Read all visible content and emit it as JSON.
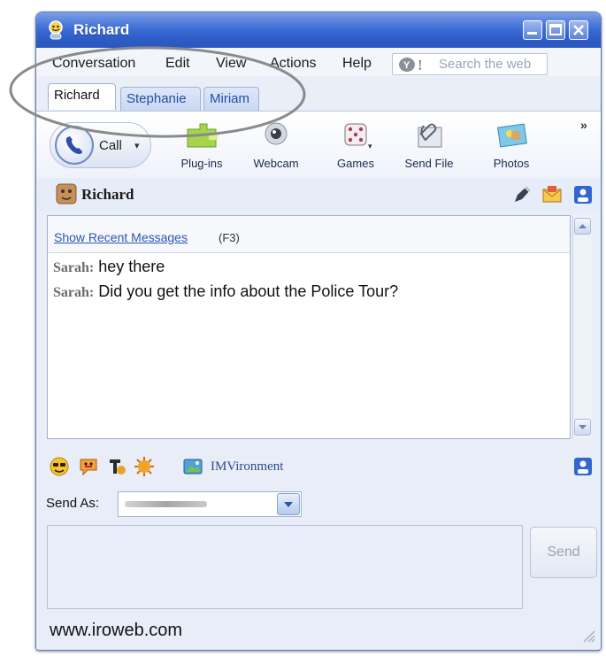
{
  "window": {
    "title": "Richard",
    "accent": "#3d6fd6"
  },
  "menu": {
    "items": [
      "Conversation",
      "Edit",
      "View",
      "Actions",
      "Help"
    ]
  },
  "search": {
    "placeholder": "Search the web"
  },
  "tabs": [
    {
      "label": "Richard",
      "active": true
    },
    {
      "label": "Stephanie",
      "active": false
    },
    {
      "label": "Miriam",
      "active": false
    }
  ],
  "toolbar": {
    "call": "Call",
    "items": [
      "Plug-ins",
      "Webcam",
      "Games",
      "Send File",
      "Photos"
    ],
    "more": "»"
  },
  "contact": {
    "name": "Richard"
  },
  "chat": {
    "recent_link": "Show Recent Messages",
    "recent_key": "(F3)",
    "messages": [
      {
        "sender": "Sarah",
        "text": "hey there"
      },
      {
        "sender": "Sarah",
        "text": "Did you get the info about the Police Tour?"
      }
    ]
  },
  "composer": {
    "imvironment": "IMVironment",
    "send_as_label": "Send As:",
    "send_button": "Send"
  },
  "footer": {
    "watermark": "www.iroweb.com"
  }
}
